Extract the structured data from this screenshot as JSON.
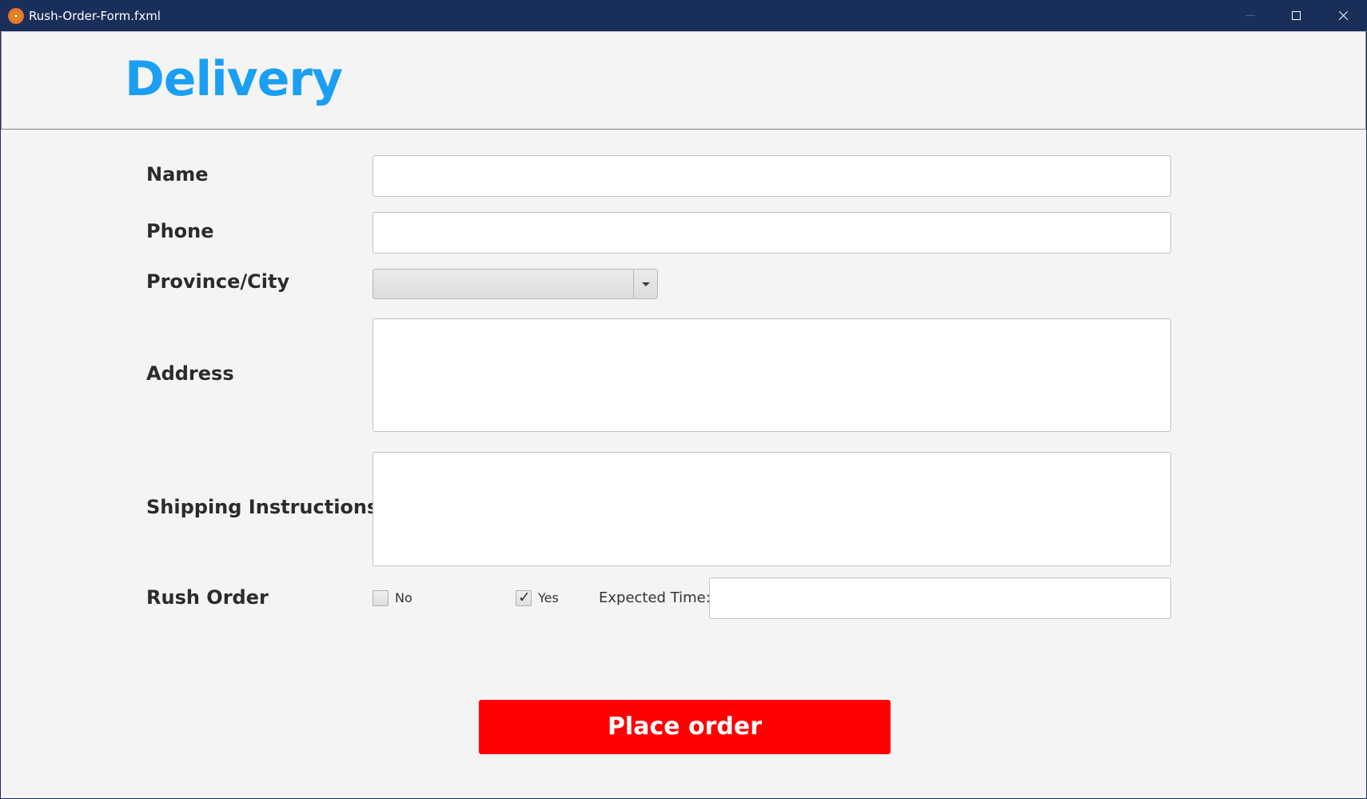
{
  "window": {
    "title": "Rush-Order-Form.fxml"
  },
  "header": {
    "title": "Delivery",
    "title_color": "#1a9ff2"
  },
  "form": {
    "name_label": "Name",
    "name_value": "",
    "phone_label": "Phone",
    "phone_value": "",
    "province_label": "Province/City",
    "province_value": "",
    "address_label": "Address",
    "address_value": "",
    "shipping_label": "Shipping Instructions",
    "shipping_value": "",
    "rush_label": "Rush Order",
    "rush_no_label": "No",
    "rush_no_checked": false,
    "rush_yes_label": "Yes",
    "rush_yes_checked": true,
    "expected_time_label": "Expected Time:",
    "expected_time_value": ""
  },
  "actions": {
    "place_order_label": "Place order",
    "place_order_color": "#ff0000"
  },
  "icons": {
    "app": "app-logo-icon",
    "minimize": "minimize-icon",
    "maximize": "maximize-icon",
    "close": "close-icon",
    "dropdown": "chevron-down-icon",
    "check": "checkmark-icon"
  }
}
